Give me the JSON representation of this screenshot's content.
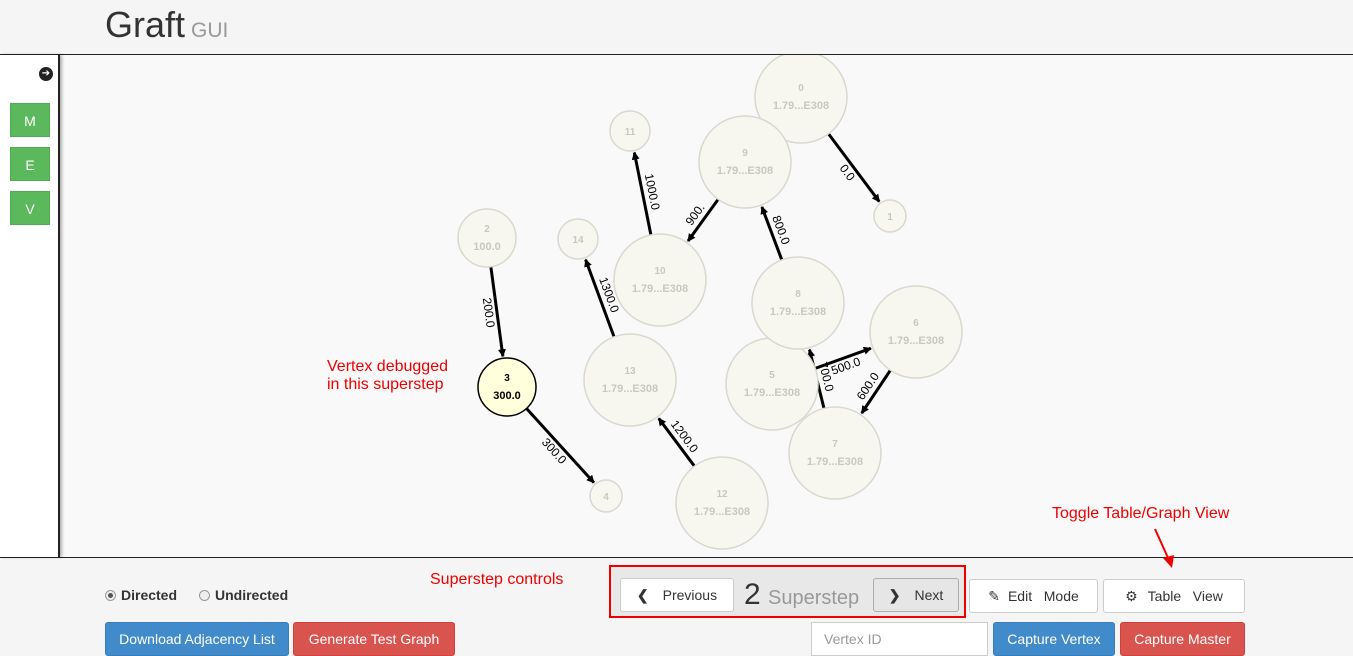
{
  "brand": {
    "title": "Graft",
    "subtitle": "GUI"
  },
  "sidebar": {
    "buttons": [
      "M",
      "E",
      "V"
    ]
  },
  "graph": {
    "vertices": [
      {
        "id": "0",
        "value": "1.79...E308"
      },
      {
        "id": "1",
        "value": ""
      },
      {
        "id": "2",
        "value": "100.0"
      },
      {
        "id": "3",
        "value": "300.0",
        "debugged": true
      },
      {
        "id": "4",
        "value": ""
      },
      {
        "id": "5",
        "value": "1.79...E308"
      },
      {
        "id": "6",
        "value": "1.79...E308"
      },
      {
        "id": "7",
        "value": "1.79...E308"
      },
      {
        "id": "8",
        "value": "1.79...E308"
      },
      {
        "id": "9",
        "value": "1.79...E308"
      },
      {
        "id": "10",
        "value": "1.79...E308"
      },
      {
        "id": "11",
        "value": ""
      },
      {
        "id": "12",
        "value": "1.79...E308"
      },
      {
        "id": "13",
        "value": "1.79...E308"
      },
      {
        "id": "14",
        "value": ""
      }
    ],
    "edges": [
      {
        "from": "0",
        "to": "1",
        "label": "0.0"
      },
      {
        "from": "2",
        "to": "3",
        "label": "200.0"
      },
      {
        "from": "3",
        "to": "4",
        "label": "300.0"
      },
      {
        "from": "9",
        "to": "10",
        "label": "900."
      },
      {
        "from": "8",
        "to": "9",
        "label": "800.0"
      },
      {
        "from": "10",
        "to": "11",
        "label": "1000.0"
      },
      {
        "from": "13",
        "to": "14",
        "label": "1300.0"
      },
      {
        "from": "12",
        "to": "13",
        "label": "1200.0"
      },
      {
        "from": "5",
        "to": "6",
        "label": "500.0"
      },
      {
        "from": "7",
        "to": "8",
        "label": "700.0"
      },
      {
        "from": "6",
        "to": "7",
        "label": "600.0"
      }
    ]
  },
  "annotations": {
    "vertex_debugged": [
      "Vertex debugged",
      "in this superstep"
    ],
    "superstep_controls": "Superstep controls",
    "toggle_view": "Toggle Table/Graph View"
  },
  "controls": {
    "directed_label": "Directed",
    "undirected_label": "Undirected",
    "download_adjacency": "Download Adjacency List",
    "generate_test_graph": "Generate Test Graph",
    "previous_label": "Previous",
    "superstep_number": "2",
    "superstep_word": "Superstep",
    "next_label": "Next",
    "edit_mode_label": "Edit   Mode",
    "table_view_label": "Table   View",
    "vertex_id_placeholder": "Vertex ID",
    "capture_vertex": "Capture Vertex",
    "capture_master": "Capture Master"
  },
  "colors": {
    "vertex_fill": "#f8f7ef",
    "debug_fill": "#ffffdc",
    "accent_green": "#5cb85c",
    "accent_blue": "#428bca",
    "accent_red": "#d9534f",
    "annotation": "#ee0000"
  }
}
